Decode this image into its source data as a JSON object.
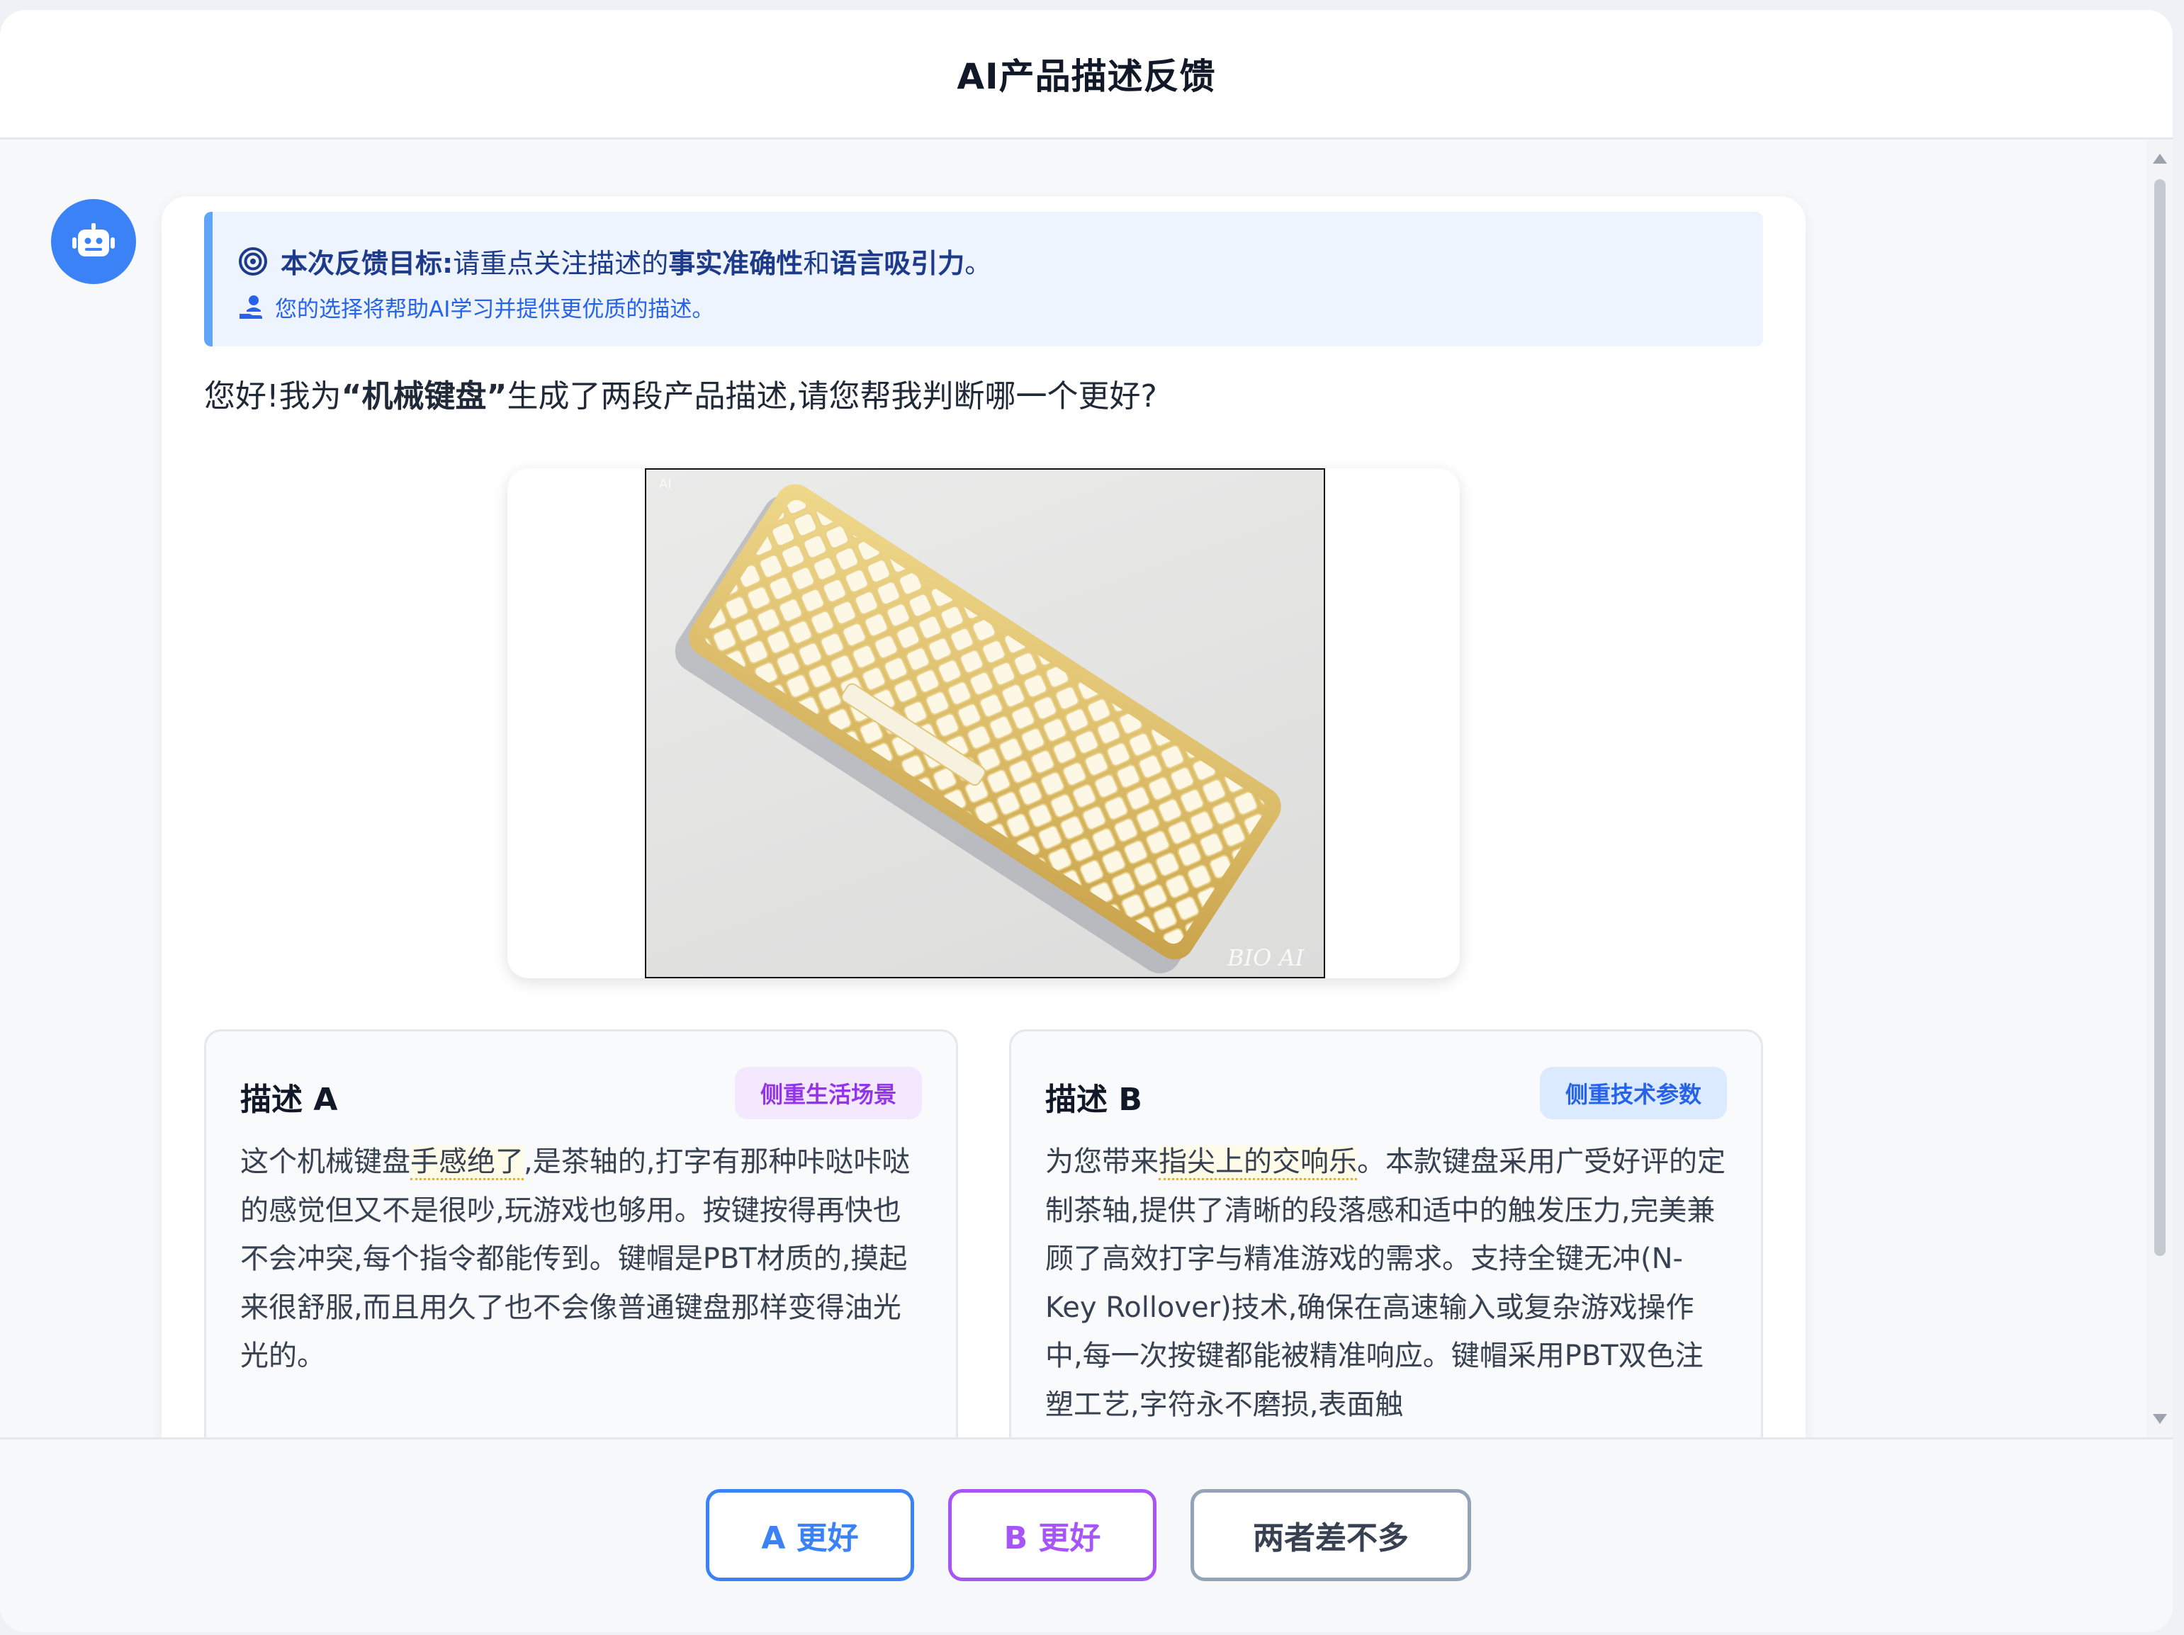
{
  "header": {
    "title": "AI产品描述反馈"
  },
  "goal": {
    "label": "本次反馈目标:",
    "prefix": "请重点关注描述的",
    "focus1": "事实准确性",
    "conj": "和",
    "focus2": "语言吸引力",
    "end": "。",
    "note": "您的选择将帮助AI学习并提供更优质的描述。"
  },
  "intro": {
    "before": "您好!我为",
    "product": "“机械键盘”",
    "after": "生成了两段产品描述,请您帮我判断哪一个更好?"
  },
  "image": {
    "watermark_small": "AI",
    "watermark": "BIO AI"
  },
  "description_a": {
    "title": "描述 A",
    "badge": "侧重生活场景",
    "pre": "这个机械键盘",
    "highlight": "手感绝了",
    "body": ",是茶轴的,打字有那种咔哒咔哒的感觉但又不是很吵,玩游戏也够用。按键按得再快也不会冲突,每个指令都能传到。键帽是PBT材质的,摸起来很舒服,而且用久了也不会像普通键盘那样变得油光光的。"
  },
  "description_b": {
    "title": "描述 B",
    "badge": "侧重技术参数",
    "pre": "为您带来",
    "highlight": "指尖上的交响乐",
    "body": "。本款键盘采用广受好评的定制茶轴,提供了清晰的段落感和适中的触发压力,完美兼顾了高效打字与精准游戏的需求。支持全键无冲(N-Key Rollover)技术,确保在高速输入或复杂游戏操作中,每一次按键都能被精准响应。键帽采用PBT双色注塑工艺,字符永不磨损,表面触"
  },
  "buttons": {
    "a_better": "A 更好",
    "b_better": "B 更好",
    "similar": "两者差不多"
  },
  "colors": {
    "primary": "#3b82f6",
    "purple": "#a855f7",
    "neutral": "#94a3b8",
    "goal_bg": "#eef4fe"
  },
  "icons": {
    "avatar": "robot-icon",
    "goal": "target-icon",
    "note": "hand-user-icon"
  }
}
